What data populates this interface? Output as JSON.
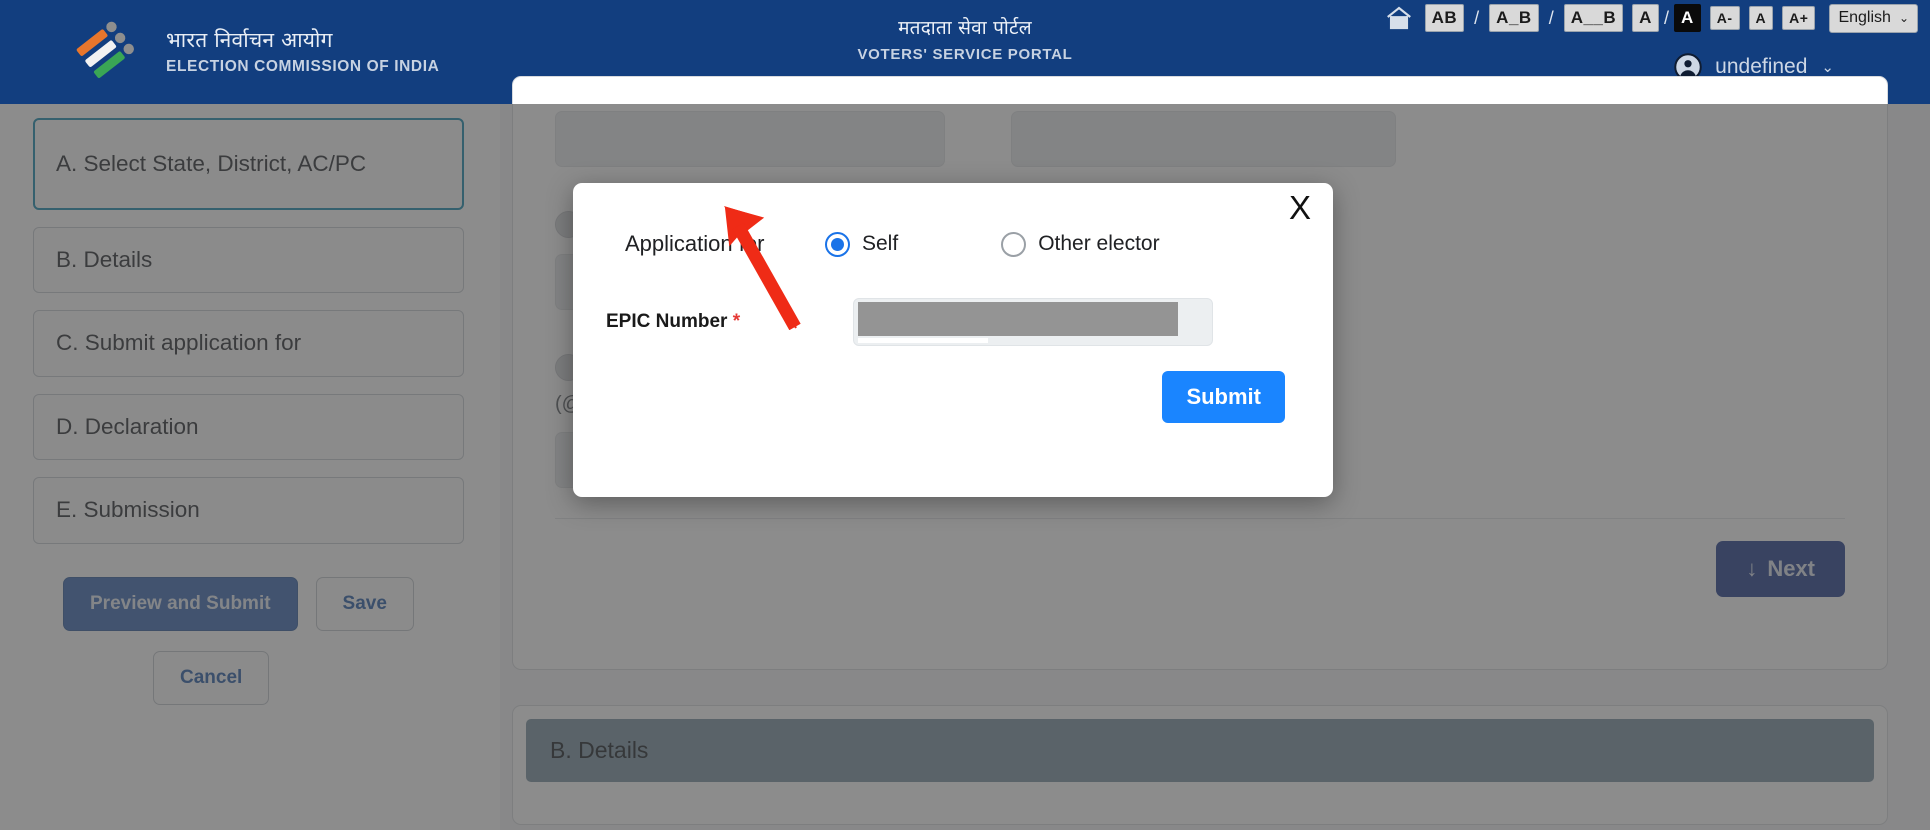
{
  "header": {
    "brand": {
      "title_hi": "भारत निर्वाचन आयोग",
      "title_en": "ELECTION COMMISSION OF INDIA",
      "logo_icon": "eci-logo-icon"
    },
    "portal": {
      "title_hi": "मतदाता सेवा पोर्टल",
      "title_en": "VOTERS' SERVICE PORTAL"
    },
    "accessibility": {
      "home_icon": "home-icon",
      "spacing_normal": "AB",
      "spacing_medium": "A_B",
      "spacing_wide": "A__B",
      "contrast_light": "A",
      "contrast_dark": "A",
      "font_decrease": "A-",
      "font_normal": "A",
      "font_increase": "A+",
      "separator": "/"
    },
    "language": {
      "label": "English",
      "chevron": "⌄"
    },
    "user": {
      "name": "undefined",
      "icon": "user-account-icon",
      "chevron": "⌄"
    }
  },
  "sidebar": {
    "steps": [
      {
        "label": "A. Select State, District, AC/PC",
        "active": true
      },
      {
        "label": "B. Details",
        "active": false
      },
      {
        "label": "C. Submit application for",
        "active": false
      },
      {
        "label": "D. Declaration",
        "active": false
      },
      {
        "label": "E. Submission",
        "active": false
      }
    ],
    "buttons": {
      "preview_submit": "Preview and Submit",
      "save": "Save",
      "cancel": "Cancel"
    }
  },
  "main": {
    "background_note": "(@Ou",
    "next_button": {
      "label": "Next",
      "icon": "arrow-down-icon"
    },
    "section_b": {
      "label": "B. Details"
    }
  },
  "modal": {
    "close_label": "X",
    "application_for_label": "Application for",
    "options": [
      {
        "label": "Self",
        "selected": true
      },
      {
        "label": "Other elector",
        "selected": false
      }
    ],
    "epic": {
      "label": "EPIC Number",
      "required_mark": "*",
      "value": "",
      "placeholder": "",
      "redacted": true
    },
    "submit_label": "Submit"
  },
  "annotation": {
    "arrow_color": "#ef2b16",
    "points_at": "self-radio"
  },
  "colors": {
    "header_blue": "#123e7f",
    "accent_blue": "#1a73e8",
    "submit_blue": "#1a85ff",
    "next_blue": "#25408f",
    "active_step_border": "#1b8cb0",
    "section_band": "#7b94a3",
    "required_red": "#e53935"
  }
}
